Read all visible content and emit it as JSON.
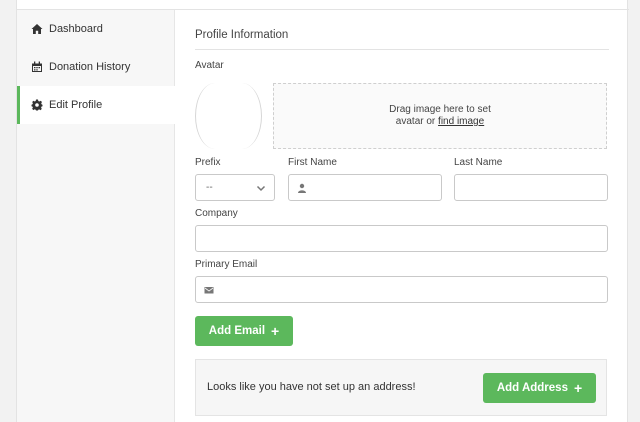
{
  "sidebar": {
    "items": [
      {
        "label": "Dashboard",
        "icon": "home-icon",
        "active": false
      },
      {
        "label": "Donation History",
        "icon": "calendar-icon",
        "active": false
      },
      {
        "label": "Edit Profile",
        "icon": "gear-icon",
        "active": true
      }
    ]
  },
  "profile": {
    "section_title": "Profile Information",
    "avatar_label": "Avatar",
    "dropzone_line1": "Drag image here to set",
    "dropzone_line2_prefix": "avatar or ",
    "dropzone_link": "find image",
    "prefix_label": "Prefix",
    "prefix_value": "--",
    "first_name_label": "First Name",
    "first_name_value": "",
    "last_name_label": "Last Name",
    "last_name_value": "",
    "company_label": "Company",
    "company_value": "",
    "email_label": "Primary Email",
    "email_value": "",
    "add_email_label": "Add Email",
    "address_message": "Looks like you have not set up an address!",
    "add_address_label": "Add Address"
  },
  "colors": {
    "accent": "#5cb85c",
    "sidebar_bg": "#f7f7f7",
    "text": "#444444"
  }
}
